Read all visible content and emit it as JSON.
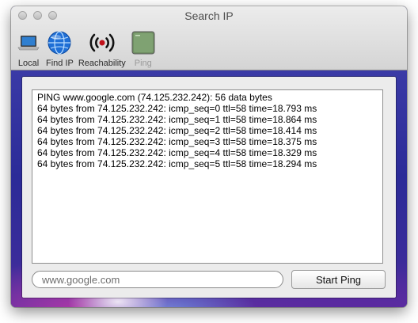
{
  "window": {
    "title": "Search IP"
  },
  "toolbar": {
    "items": [
      {
        "label": "Local",
        "icon": "laptop-icon"
      },
      {
        "label": "Find IP",
        "icon": "globe-icon"
      },
      {
        "label": "Reachability",
        "icon": "broadcast-icon"
      },
      {
        "label": "Ping",
        "icon": "terminal-icon",
        "disabled": true
      }
    ]
  },
  "ping_log": {
    "lines": [
      "PING www.google.com (74.125.232.242): 56 data bytes",
      "64 bytes from 74.125.232.242: icmp_seq=0 ttl=58 time=18.793 ms",
      "64 bytes from 74.125.232.242: icmp_seq=1 ttl=58 time=18.864 ms",
      "64 bytes from 74.125.232.242: icmp_seq=2 ttl=58 time=18.414 ms",
      "64 bytes from 74.125.232.242: icmp_seq=3 ttl=58 time=18.375 ms",
      "64 bytes from 74.125.232.242: icmp_seq=4 ttl=58 time=18.329 ms",
      "64 bytes from 74.125.232.242: icmp_seq=5 ttl=58 time=18.294 ms"
    ]
  },
  "host_input": {
    "placeholder": "www.google.com",
    "value": ""
  },
  "start_button": {
    "label": "Start Ping"
  }
}
